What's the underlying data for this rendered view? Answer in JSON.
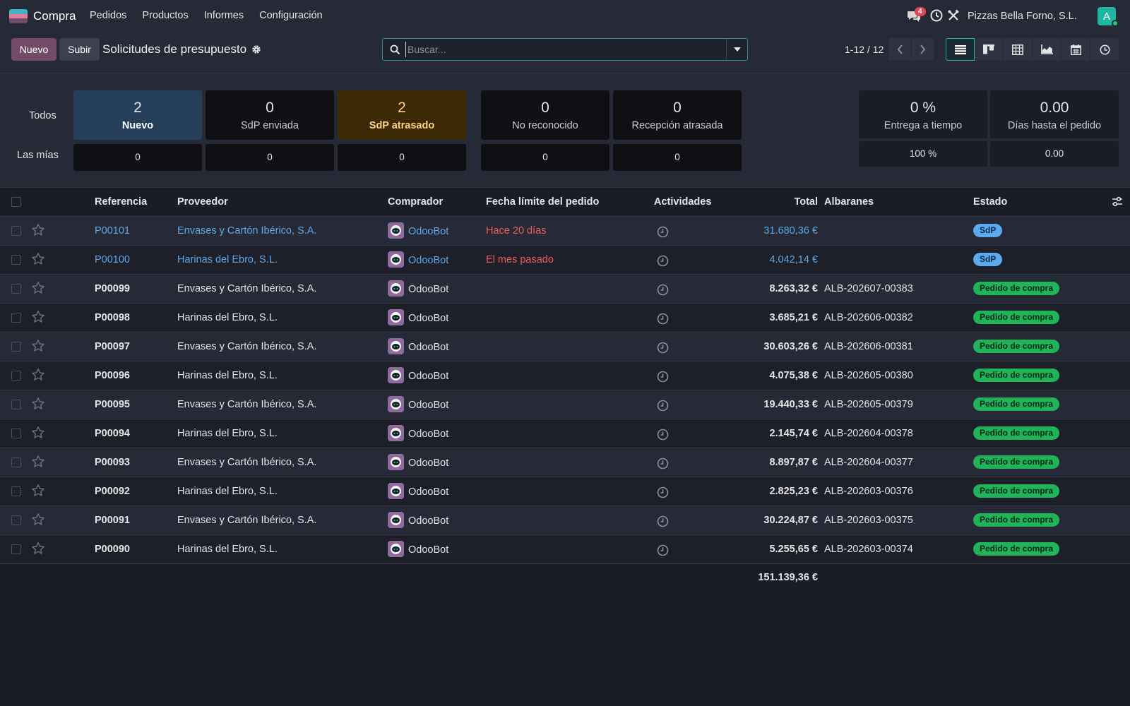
{
  "topnav": {
    "app_name": "Compra",
    "menu": [
      "Pedidos",
      "Productos",
      "Informes",
      "Configuración"
    ],
    "chat_badge": "4",
    "company": "Pizzas Bella Forno, S.L.",
    "avatar_letter": "A",
    "logo_colors": [
      "#3fb4c8",
      "#e77b9d",
      "#714b67"
    ]
  },
  "controlpanel": {
    "new_label": "Nuevo",
    "upload_label": "Subir",
    "title": "Solicitudes de presupuesto",
    "search_placeholder": "Buscar...",
    "pager": "1-12 / 12",
    "views": [
      "list-icon",
      "kanban-icon",
      "pivot-icon",
      "graph-icon",
      "calendar-icon",
      "activity-icon"
    ]
  },
  "dashboard": {
    "row_all_label": "Todos",
    "row_mine_label": "Las mías",
    "tiles": [
      {
        "num": "2",
        "label": "Nuevo",
        "mine": "0"
      },
      {
        "num": "0",
        "label": "SdP enviada",
        "mine": "0"
      },
      {
        "num": "2",
        "label": "SdP atrasado",
        "mine": "0"
      },
      {
        "num": "0",
        "label": "No reconocido",
        "mine": "0"
      },
      {
        "num": "0",
        "label": "Recepción atrasada",
        "mine": "0"
      }
    ],
    "kpis": [
      {
        "num": "0 %",
        "label": "Entrega a tiempo",
        "mine": "100 %"
      },
      {
        "num": "0.00",
        "label": "Días hasta el pedido",
        "mine": "0.00"
      }
    ]
  },
  "table": {
    "headers": {
      "reference": "Referencia",
      "vendor": "Proveedor",
      "buyer": "Comprador",
      "deadline": "Fecha límite del pedido",
      "activities": "Actividades",
      "total": "Total",
      "receipts": "Albaranes",
      "status": "Estado"
    },
    "rows": [
      {
        "ref": "P00101",
        "vendor": "Envases y Cartón Ibérico, S.A.",
        "buyer": "OdooBot",
        "deadline": "Hace 20 días",
        "total": "31.680,36 €",
        "receipt": "",
        "status": "SdP"
      },
      {
        "ref": "P00100",
        "vendor": "Harinas del Ebro, S.L.",
        "buyer": "OdooBot",
        "deadline": "El mes pasado",
        "total": "4.042,14 €",
        "receipt": "",
        "status": "SdP"
      },
      {
        "ref": "P00099",
        "vendor": "Envases y Cartón Ibérico, S.A.",
        "buyer": "OdooBot",
        "deadline": "",
        "total": "8.263,32 €",
        "receipt": "ALB-202607-00383",
        "status": "Pedido de compra"
      },
      {
        "ref": "P00098",
        "vendor": "Harinas del Ebro, S.L.",
        "buyer": "OdooBot",
        "deadline": "",
        "total": "3.685,21 €",
        "receipt": "ALB-202606-00382",
        "status": "Pedido de compra"
      },
      {
        "ref": "P00097",
        "vendor": "Envases y Cartón Ibérico, S.A.",
        "buyer": "OdooBot",
        "deadline": "",
        "total": "30.603,26 €",
        "receipt": "ALB-202606-00381",
        "status": "Pedido de compra"
      },
      {
        "ref": "P00096",
        "vendor": "Harinas del Ebro, S.L.",
        "buyer": "OdooBot",
        "deadline": "",
        "total": "4.075,38 €",
        "receipt": "ALB-202605-00380",
        "status": "Pedido de compra"
      },
      {
        "ref": "P00095",
        "vendor": "Envases y Cartón Ibérico, S.A.",
        "buyer": "OdooBot",
        "deadline": "",
        "total": "19.440,33 €",
        "receipt": "ALB-202605-00379",
        "status": "Pedido de compra"
      },
      {
        "ref": "P00094",
        "vendor": "Harinas del Ebro, S.L.",
        "buyer": "OdooBot",
        "deadline": "",
        "total": "2.145,74 €",
        "receipt": "ALB-202604-00378",
        "status": "Pedido de compra"
      },
      {
        "ref": "P00093",
        "vendor": "Envases y Cartón Ibérico, S.A.",
        "buyer": "OdooBot",
        "deadline": "",
        "total": "8.897,87 €",
        "receipt": "ALB-202604-00377",
        "status": "Pedido de compra"
      },
      {
        "ref": "P00092",
        "vendor": "Harinas del Ebro, S.L.",
        "buyer": "OdooBot",
        "deadline": "",
        "total": "2.825,23 €",
        "receipt": "ALB-202603-00376",
        "status": "Pedido de compra"
      },
      {
        "ref": "P00091",
        "vendor": "Envases y Cartón Ibérico, S.A.",
        "buyer": "OdooBot",
        "deadline": "",
        "total": "30.224,87 €",
        "receipt": "ALB-202603-00375",
        "status": "Pedido de compra"
      },
      {
        "ref": "P00090",
        "vendor": "Harinas del Ebro, S.L.",
        "buyer": "OdooBot",
        "deadline": "",
        "total": "5.255,65 €",
        "receipt": "ALB-202603-00374",
        "status": "Pedido de compra"
      }
    ],
    "grand_total": "151.139,36 €"
  }
}
